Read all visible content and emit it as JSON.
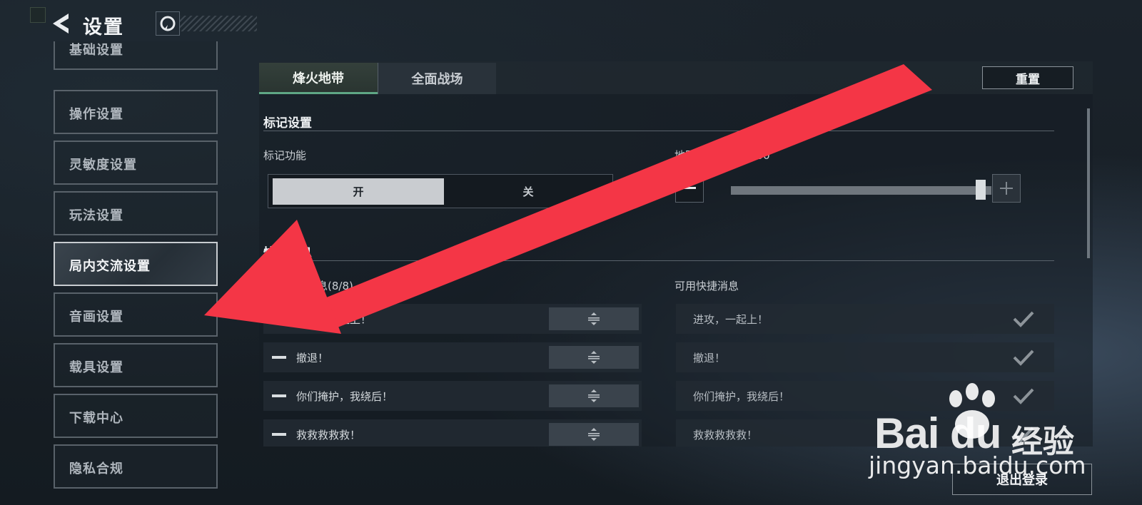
{
  "header": {
    "title": "设置"
  },
  "sidebar": {
    "items": [
      {
        "label": "基础设置"
      },
      {
        "label": "操作设置"
      },
      {
        "label": "灵敏度设置"
      },
      {
        "label": "玩法设置"
      },
      {
        "label": "局内交流设置",
        "active": true
      },
      {
        "label": "音画设置"
      },
      {
        "label": "载具设置"
      },
      {
        "label": "下载中心"
      },
      {
        "label": "隐私合规"
      }
    ]
  },
  "tabs": [
    {
      "label": "烽火地带",
      "active": true
    },
    {
      "label": "全面战场"
    }
  ],
  "reset_label": "重置",
  "mark_section": {
    "title": "标记设置",
    "mark_feature_label": "标记功能",
    "toggle": {
      "on": "开",
      "off": "关",
      "selected": "开"
    },
    "opacity_label": "地图标透明度：100",
    "opacity_value": 100
  },
  "quick_section": {
    "title": "快捷消息",
    "current_label": "当前快捷消息(8/8)",
    "available_label": "可用快捷消息",
    "current_items": [
      "进攻，一起上！",
      "撤退！",
      "你们掩护，我绕后！",
      "救救救救救！"
    ],
    "available_items": [
      "进攻，一起上！",
      "撤退！",
      "你们掩护，我绕后！",
      "救救救救救！"
    ]
  },
  "logout_label": "退出登录",
  "watermark": {
    "brand": "Bai du",
    "cn": "经验",
    "url": "jingyan.baidu.com"
  },
  "colors": {
    "annotation_arrow": "#f43646",
    "tab_accent": "#5fa785"
  },
  "icons": {
    "back": "back-arrow-icon",
    "support": "headset-icon",
    "minus": "minus-icon",
    "plus": "plus-icon",
    "drag": "drag-handle-icon",
    "check": "check-icon",
    "paw": "paw-icon"
  }
}
